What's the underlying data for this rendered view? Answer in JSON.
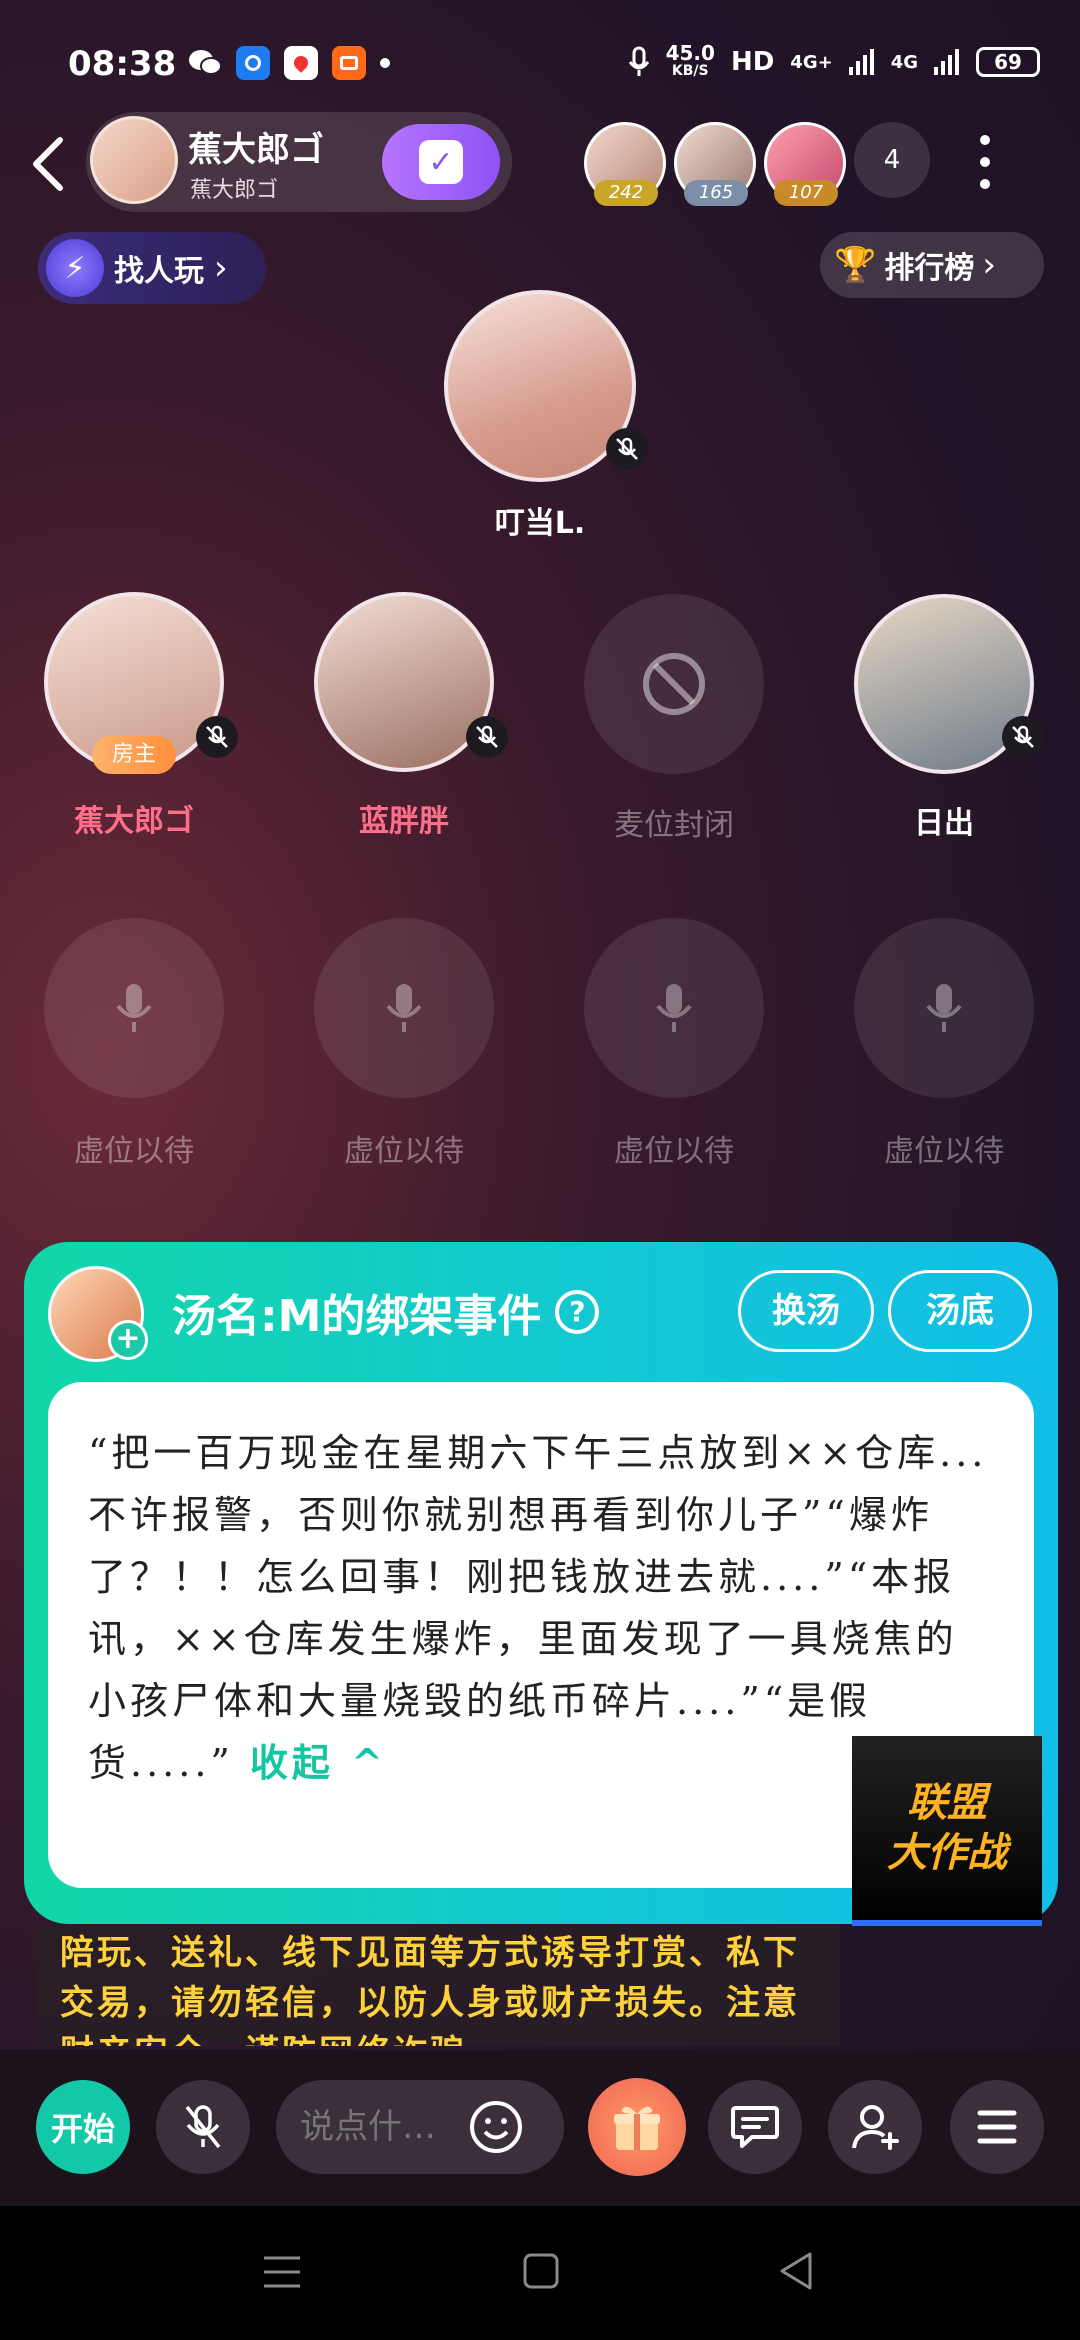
{
  "status_bar": {
    "time": "08:38",
    "net_speed_value": "45.0",
    "net_speed_unit": "KB/S",
    "hd": "HD",
    "net1": "4G+",
    "net2": "4G",
    "battery": "69"
  },
  "header": {
    "room_name": "蕉大郎ゴ",
    "room_sub": "蕉大郎ゴ",
    "audience": [
      {
        "badge": "242",
        "badge_color": "#c9a52a"
      },
      {
        "badge": "165",
        "badge_color": "#7d8fa8"
      },
      {
        "badge": "107",
        "badge_color": "#c98a2a"
      }
    ],
    "audience_count": "4"
  },
  "actions": {
    "find_label": "找人玩",
    "rank_label": "排行榜"
  },
  "host": {
    "name": "叮当L."
  },
  "seats_row1": [
    {
      "name": "蕉大郎ゴ",
      "tag": "房主",
      "color": "#ff6f8a"
    },
    {
      "name": "蓝胖胖",
      "color": "#ff6f8a"
    },
    {
      "name": "麦位封闭",
      "color": "rgba(255,255,255,0.4)"
    },
    {
      "name": "日出",
      "color": "#ffffff"
    }
  ],
  "seats_row2": [
    {
      "label": "虚位以待"
    },
    {
      "label": "虚位以待"
    },
    {
      "label": "虚位以待"
    },
    {
      "label": "虚位以待"
    }
  ],
  "game": {
    "title": "汤名:M的绑架事件",
    "swap_btn": "换汤",
    "answer_btn": "汤底",
    "story": "“把一百万现金在星期六下午三点放到××仓库...不许报警，否则你就别想再看到你儿子”“爆炸了？！！怎么回事！刚把钱放进去就....”“本报讯，××仓库发生爆炸，里面发现了一具烧焦的小孩尸体和大量烧毁的纸币碎片....”“是假货.....”",
    "collapse": "收起"
  },
  "league": {
    "line1": "联盟",
    "line2": "大作战"
  },
  "notice": "陪玩、送礼、线下见面等方式诱导打赏、私下交易，请勿轻信，以防人身或财产损失。注意财产安全，谨防网络诈骗。",
  "toolbar": {
    "start": "开始",
    "input_placeholder": "说点什…"
  }
}
